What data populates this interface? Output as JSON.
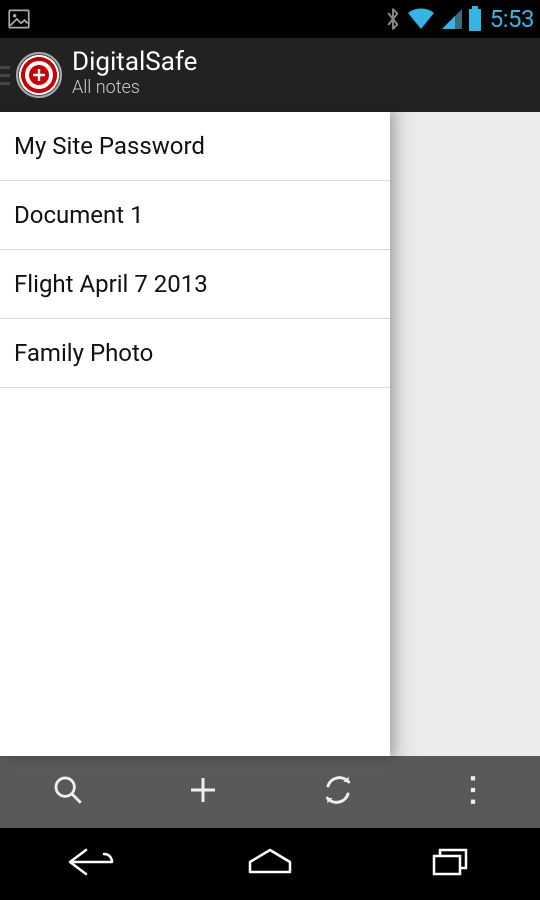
{
  "status": {
    "time": "5:53"
  },
  "header": {
    "app_title": "DigitalSafe",
    "subtitle": "All notes"
  },
  "notes": [
    {
      "title": "My Site Password"
    },
    {
      "title": "Document 1"
    },
    {
      "title": "Flight April 7 2013"
    },
    {
      "title": "Family Photo"
    }
  ]
}
